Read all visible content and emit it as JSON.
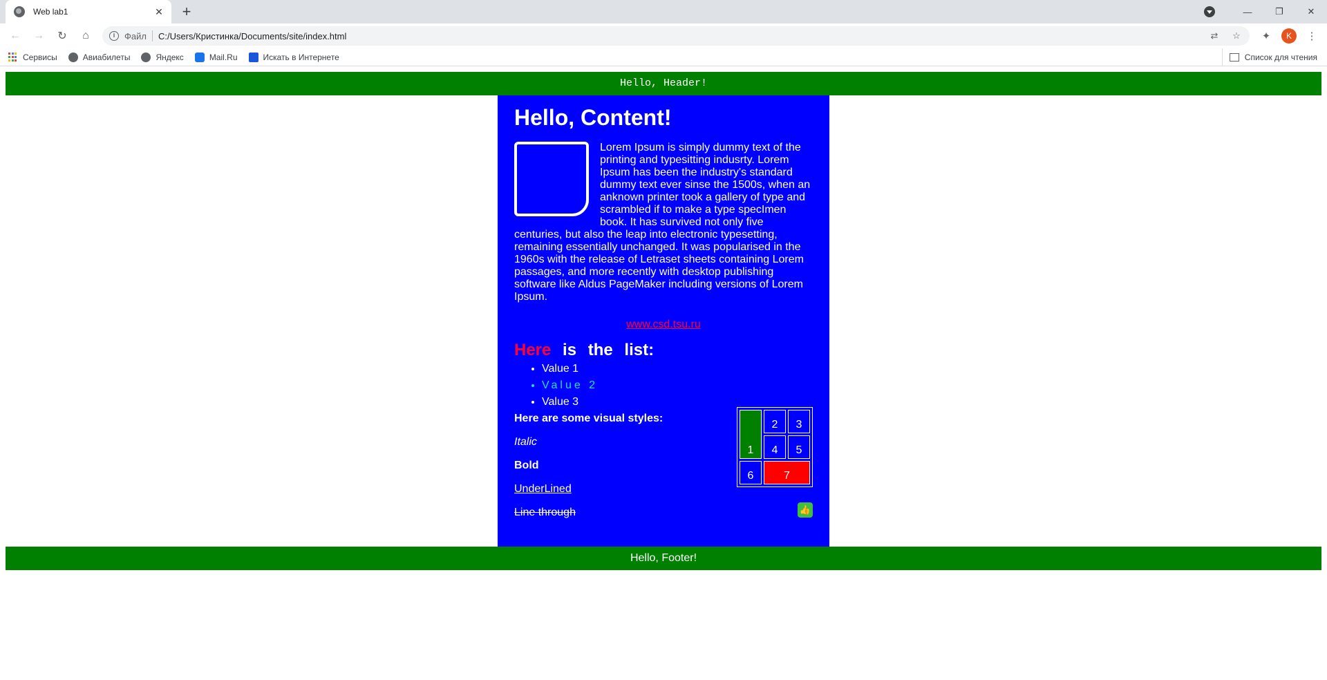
{
  "browser": {
    "tab_title": "Web lab1",
    "tab_close": "✕",
    "new_tab": "+",
    "url_scheme": "Файл",
    "url": "C:/Users/Кристинка/Documents/site/index.html",
    "profile_initial": "K",
    "bookmarks": [
      {
        "label": "Сервисы",
        "icon": "apps-grid-icon"
      },
      {
        "label": "Авиабилеты",
        "icon": "globe-icon"
      },
      {
        "label": "Яндекс",
        "icon": "globe-icon"
      },
      {
        "label": "Mail.Ru",
        "icon": "mail-icon"
      },
      {
        "label": "Искать в Интернете",
        "icon": "search-icon"
      }
    ],
    "reading_list": "Список для чтения"
  },
  "page": {
    "header": "Hello, Header!",
    "content_title": "Hello, Content!",
    "lorem": "Lorem Ipsum is simply dummy text of the printing and typesitting indusrty. Lorem Ipsum has been the industry's standard dummy text ever sinse the 1500s, when an anknown printer took a gallery of type and scrambled if to make a type specImen book. It has survived not only five centuries, but also the leap into electronic typesetting, remaining essentially unchanged. It was popularised in the 1960s with the release of Letraset sheets containing Lorem passages, and more recently with desktop publishing software like Aldus PageMaker including versions of Lorem Ipsum.",
    "link": "www.csd.tsu.ru",
    "list_title_here": "Here",
    "list_title_rest": "is the list:",
    "list_items": [
      "Value 1",
      "Value 2",
      "Value 3"
    ],
    "styles_title": "Here are some visual styles:",
    "style_italic": "Italic",
    "style_bold": "Bold",
    "style_underlined": "UnderLined",
    "style_linethrough": "Line through",
    "table_cells": [
      "1",
      "2",
      "3",
      "4",
      "5",
      "6",
      "7"
    ],
    "footer": "Hello, Footer!"
  },
  "colors": {
    "header_bg": "#008000",
    "content_bg": "#0000ff",
    "accent_red": "#ff0033",
    "value2_color": "#20e0e0"
  }
}
